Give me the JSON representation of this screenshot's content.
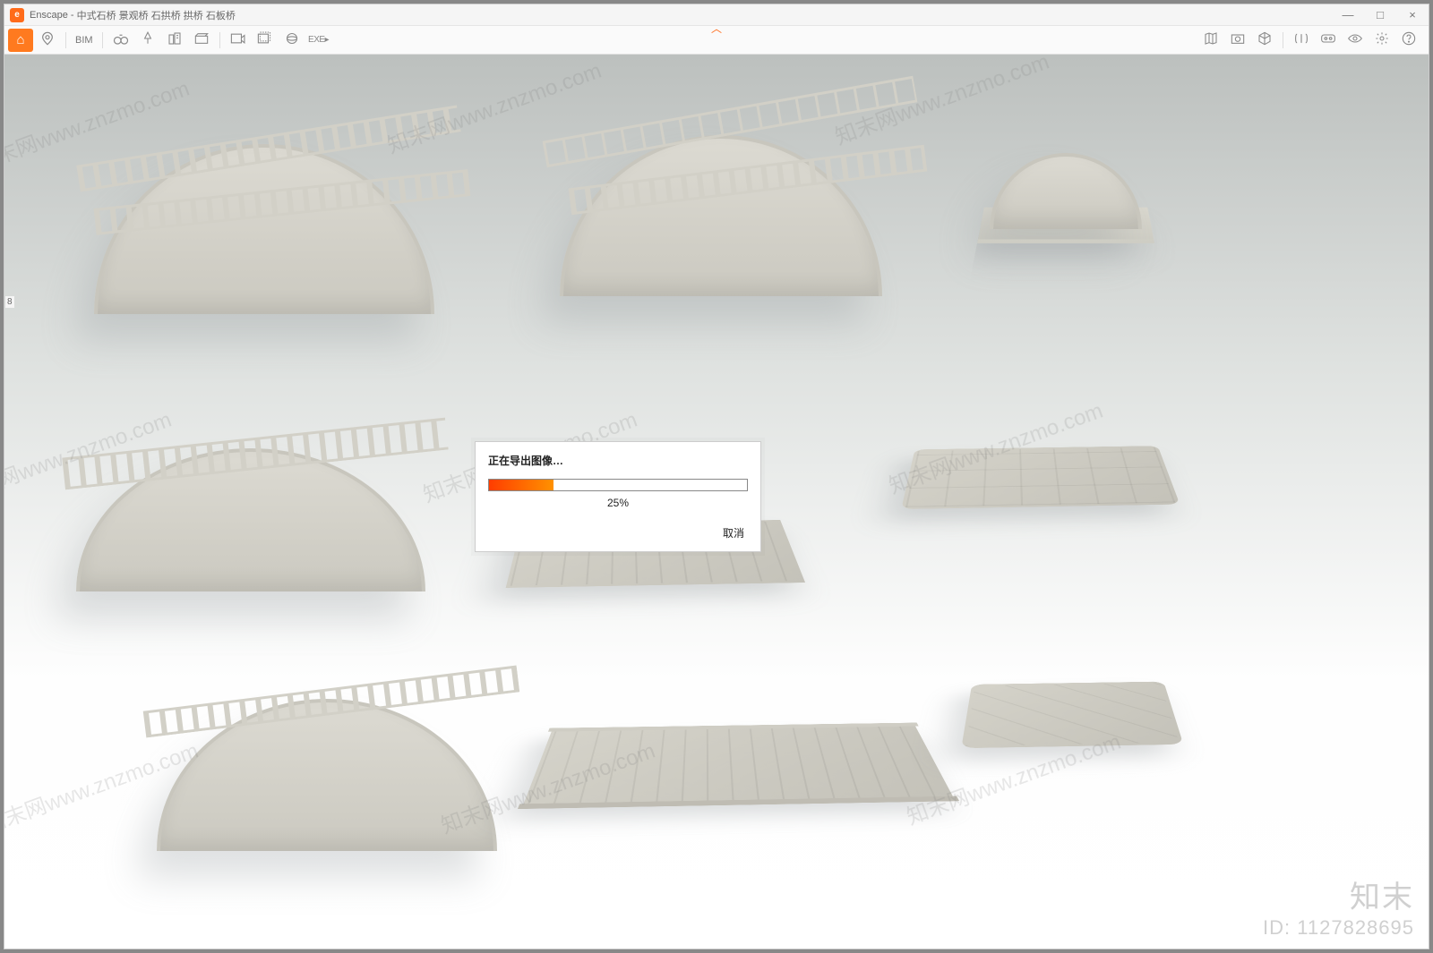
{
  "app": {
    "name": "Enscape",
    "title_suffix": "中式石桥 景观桥 石拱桥 拱桥 石板桥",
    "icon_letter": "e"
  },
  "window_controls": {
    "minimize": "—",
    "maximize": "□",
    "close": "×"
  },
  "toolbar": {
    "home": "⌂",
    "bim_label": "BIM",
    "nav_indicator": "︿"
  },
  "dialog": {
    "title": "正在导出图像…",
    "percent_text": "25%",
    "percent_value": 25,
    "cancel": "取消"
  },
  "watermarks": {
    "wm_text": "知末网www.znzmo.com",
    "brand_name": "知末",
    "brand_id": "ID: 1127828695"
  },
  "side": {
    "marker": "8"
  },
  "icons": {
    "pin": "map-pin-icon",
    "binocs": "binoculars-icon",
    "marker": "marker-icon",
    "buildings": "building-icon",
    "clapper": "clapperboard-icon",
    "export1": "export-image-icon",
    "export2": "export-batch-icon",
    "pano": "panorama-icon",
    "exe": "export-exe-icon",
    "mapfold": "map-icon",
    "screenshot": "screenshot-icon",
    "cube": "cube-icon",
    "vrsplit": "vr-split-icon",
    "vrheadset": "vr-headset-icon",
    "eye": "visibility-icon",
    "gear": "settings-icon",
    "help": "help-icon"
  },
  "colors": {
    "accent": "#ff6b1a",
    "progress_start": "#ff3d00",
    "progress_end": "#ff9100"
  }
}
